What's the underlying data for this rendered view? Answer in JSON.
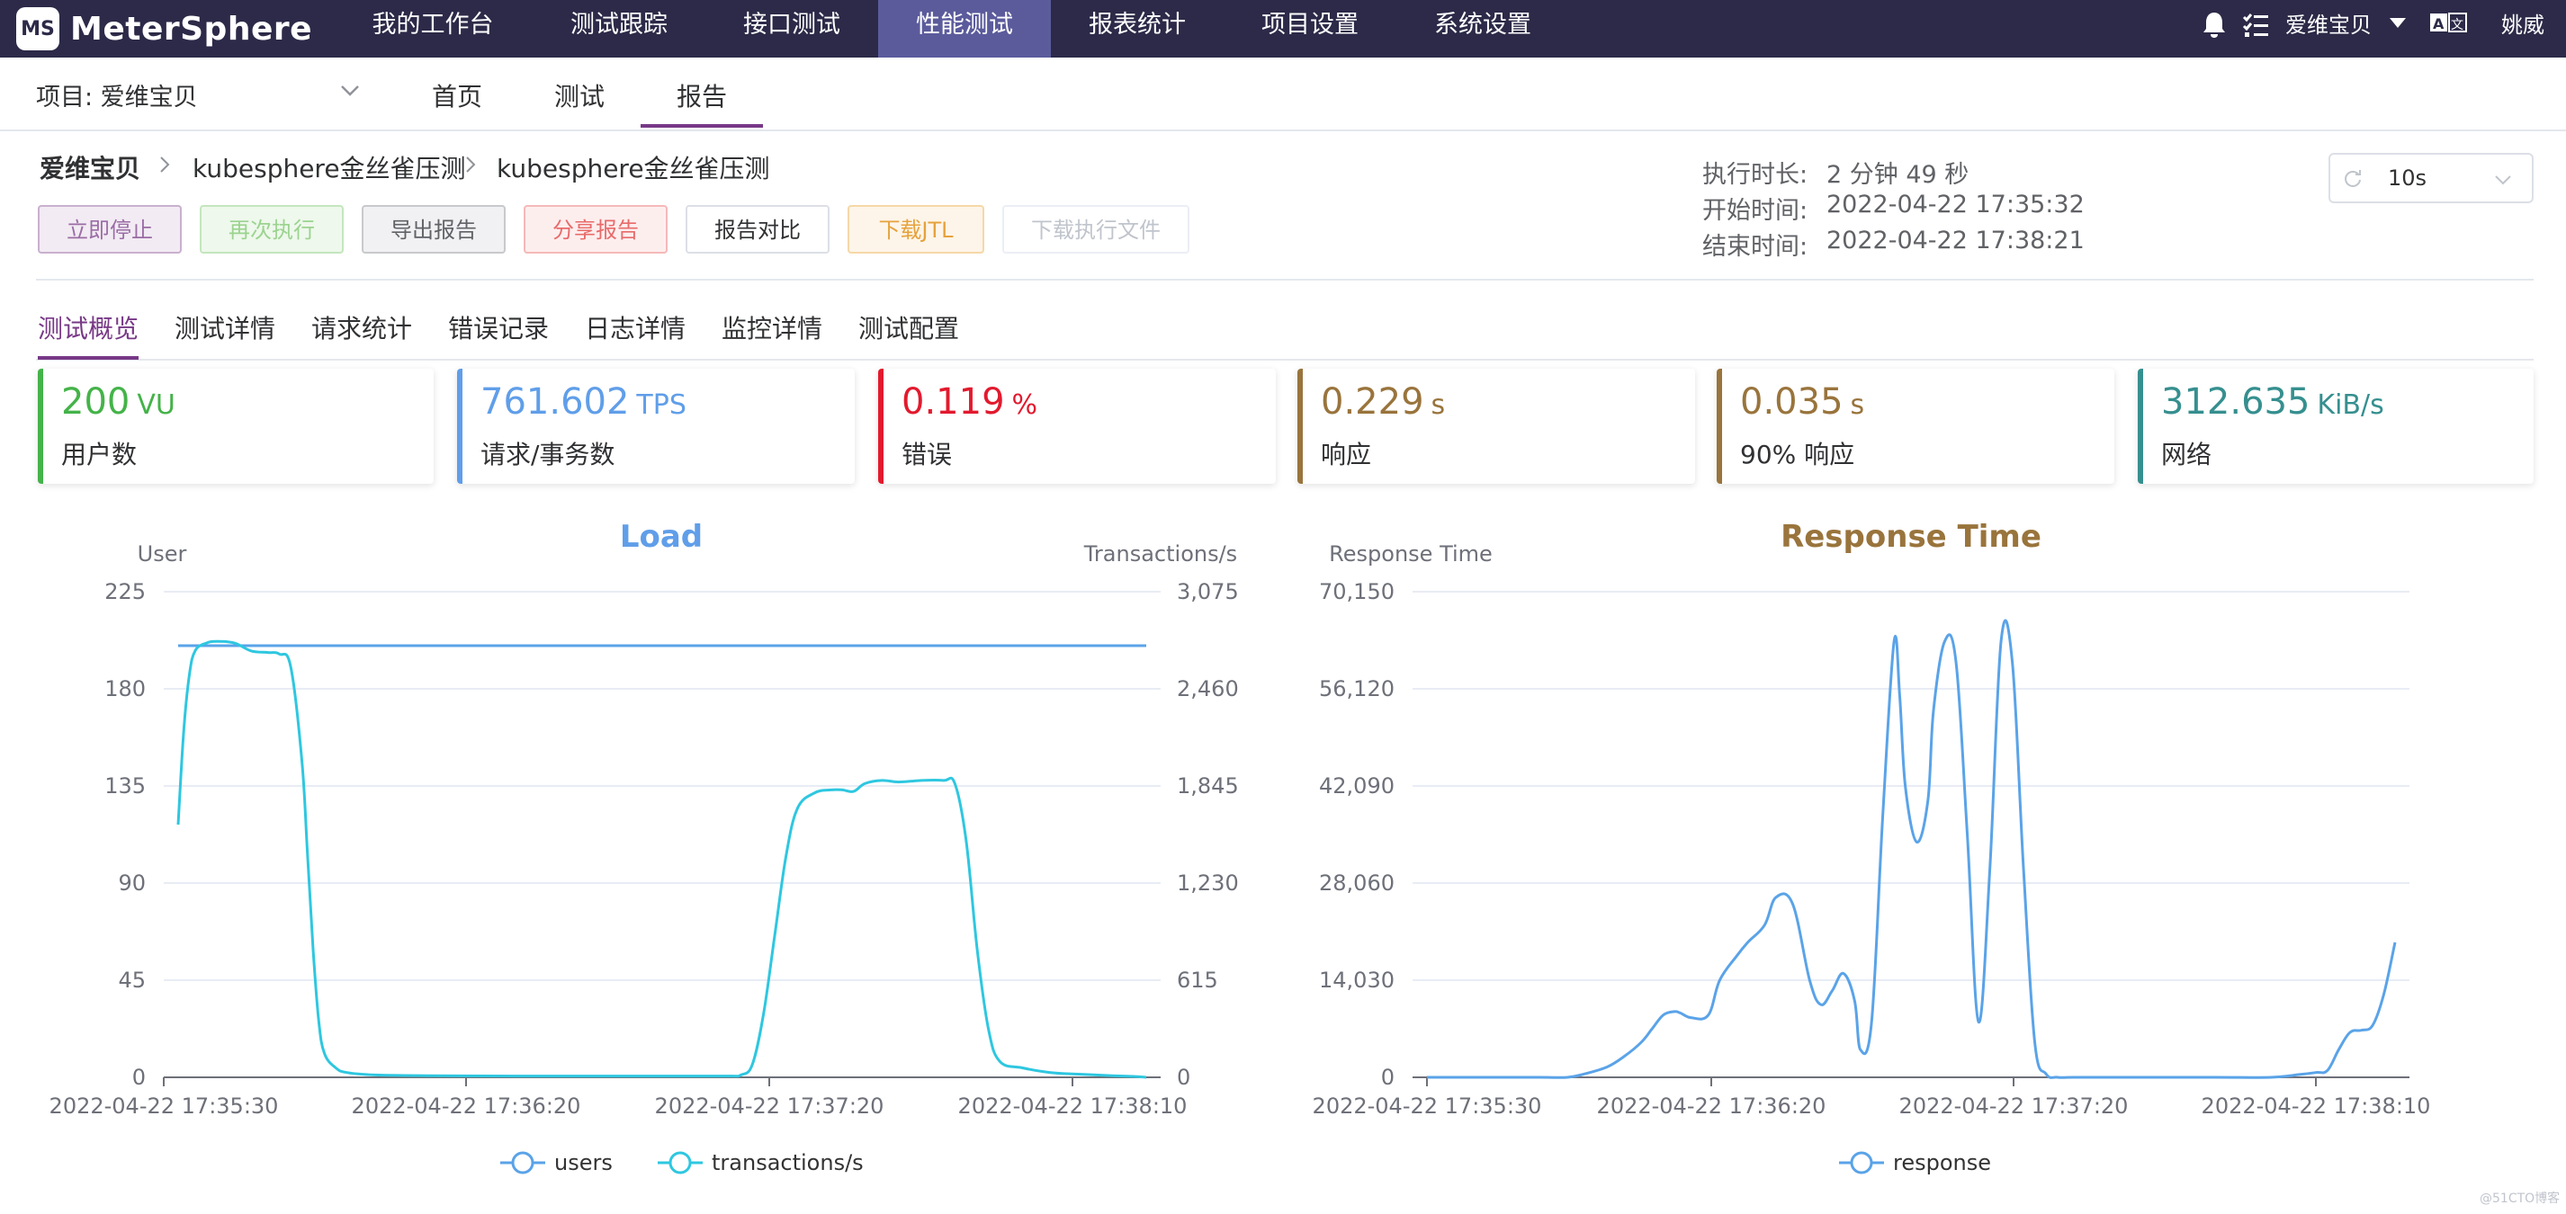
{
  "topnav": {
    "logo_text": "MeterSphere",
    "logo_mark": "MS",
    "items": [
      "我的工作台",
      "测试跟踪",
      "接口测试",
      "性能测试",
      "报表统计",
      "项目设置",
      "系统设置"
    ],
    "active": "性能测试",
    "user_workspace": "爱维宝贝",
    "lang_icon": "translate-icon",
    "user_name": "姚威"
  },
  "subnav": {
    "project_label": "项目: 爱维宝贝",
    "tabs": [
      "首页",
      "测试",
      "报告"
    ],
    "active": "报告"
  },
  "breadcrumb": [
    "爱维宝贝",
    "kubesphere金丝雀压测",
    "kubesphere金丝雀压测"
  ],
  "buttons": {
    "stop": "立即停止",
    "rerun": "再次执行",
    "export": "导出报告",
    "share": "分享报告",
    "compare": "报告对比",
    "download_jtl": "下载JTL",
    "download_files": "下载执行文件"
  },
  "meta": {
    "duration_label": "执行时长:",
    "duration_value": "2 分钟 49 秒",
    "start_label": "开始时间:",
    "start_value": "2022-04-22 17:35:32",
    "end_label": "结束时间:",
    "end_value": "2022-04-22 17:38:21",
    "refresh_interval": "10s"
  },
  "tabs": [
    "测试概览",
    "测试详情",
    "请求统计",
    "错误记录",
    "日志详情",
    "监控详情",
    "测试配置"
  ],
  "active_tab": "测试概览",
  "cards": [
    {
      "value": "200",
      "unit": "VU",
      "label": "用户数",
      "color": "#44b349"
    },
    {
      "value": "761.602",
      "unit": "TPS",
      "label": "请求/事务数",
      "color": "#609ee9"
    },
    {
      "value": "0.119",
      "unit": "%",
      "label": "错误",
      "color": "#e21a2e"
    },
    {
      "value": "0.229",
      "unit": "s",
      "label": "响应",
      "color": "#99743c"
    },
    {
      "value": "0.035",
      "unit": "s",
      "label": "90% 响应",
      "color": "#99743c"
    },
    {
      "value": "312.635",
      "unit": "KiB/s",
      "label": "网络",
      "color": "#368f8f"
    }
  ],
  "chart_data": [
    {
      "type": "line",
      "title": "Load",
      "ylabel": "User",
      "y2label": "Transactions/s",
      "ylim": [
        0,
        225
      ],
      "y2lim": [
        0,
        3075
      ],
      "yticks": [
        "0",
        "45",
        "90",
        "135",
        "180",
        "225"
      ],
      "y2ticks": [
        "0",
        "615",
        "1,230",
        "1,845",
        "2,460",
        "3,075"
      ],
      "xticks": [
        "2022-04-22 17:35:30",
        "2022-04-22 17:36:20",
        "2022-04-22 17:37:20",
        "2022-04-22 17:38:10"
      ],
      "grid": true,
      "legend_position": "bottom",
      "series": [
        {
          "name": "users",
          "axis": "left",
          "color": "#5aa3e8",
          "x": [
            0,
            2,
            4,
            6,
            8,
            10,
            12,
            14,
            16,
            18,
            20,
            22,
            24,
            26,
            28,
            30,
            32,
            34,
            36,
            38,
            40,
            42,
            44,
            46,
            48,
            50,
            52,
            54,
            56,
            58,
            60,
            62,
            64,
            66,
            68,
            70,
            72,
            74,
            76,
            78,
            80,
            82,
            84,
            86,
            88,
            90,
            92,
            94,
            96,
            98,
            100,
            102,
            104,
            106,
            108,
            110,
            112,
            114,
            116,
            118,
            120,
            122,
            124,
            126,
            128,
            130,
            132,
            134,
            136,
            138,
            140,
            142,
            144,
            146,
            148,
            150,
            152,
            154,
            156,
            158,
            160,
            162,
            164,
            166,
            168,
            170,
            172
          ],
          "y": [
            200,
            200,
            200,
            200,
            200,
            200,
            200,
            200,
            200,
            200,
            200,
            200,
            200,
            200,
            200,
            200,
            200,
            200,
            200,
            200,
            200,
            200,
            200,
            200,
            200,
            200,
            200,
            200,
            200,
            200,
            200,
            200,
            200,
            200,
            200,
            200,
            200,
            200,
            200,
            200,
            200,
            200,
            200,
            200,
            200,
            200,
            200,
            200,
            200,
            200,
            200,
            200,
            200,
            200,
            200,
            200,
            200,
            200,
            200,
            200,
            200,
            200,
            200,
            200,
            200,
            200,
            200,
            200,
            200,
            200,
            200,
            200,
            200,
            200,
            200,
            200,
            200,
            200,
            200,
            200,
            200,
            200,
            200,
            200,
            200,
            200,
            200
          ]
        },
        {
          "name": "transactions/s",
          "axis": "right",
          "color": "#2ec7e0",
          "x": [
            0,
            1,
            2,
            3,
            5,
            7,
            10,
            13,
            16,
            18,
            20,
            22,
            23,
            24,
            25,
            26,
            28,
            30,
            35,
            45,
            60,
            75,
            90,
            98,
            100,
            102,
            104,
            106,
            108,
            110,
            113,
            116,
            118,
            120,
            122,
            125,
            128,
            132,
            136,
            138,
            140,
            142,
            144,
            146,
            150,
            155,
            160,
            166,
            170,
            172
          ],
          "y": [
            1600,
            2200,
            2550,
            2700,
            2750,
            2760,
            2750,
            2700,
            2690,
            2680,
            2600,
            2000,
            1400,
            800,
            350,
            150,
            60,
            30,
            15,
            10,
            8,
            8,
            8,
            8,
            15,
            80,
            400,
            900,
            1400,
            1700,
            1800,
            1820,
            1820,
            1810,
            1860,
            1880,
            1870,
            1880,
            1880,
            1860,
            1500,
            800,
            300,
            100,
            60,
            30,
            20,
            10,
            5,
            0
          ]
        }
      ]
    },
    {
      "type": "line",
      "title": "Response Time",
      "ylabel": "Response Time",
      "ylim": [
        0,
        70150
      ],
      "yticks": [
        "0",
        "14,030",
        "28,060",
        "42,090",
        "56,120",
        "70,150"
      ],
      "xticks": [
        "2022-04-22 17:35:30",
        "2022-04-22 17:36:20",
        "2022-04-22 17:37:20",
        "2022-04-22 17:38:10"
      ],
      "grid": true,
      "legend_position": "bottom",
      "series": [
        {
          "name": "response",
          "color": "#5aa3e8",
          "x": [
            0,
            10,
            20,
            25,
            28,
            32,
            35,
            38,
            40,
            42,
            44,
            45,
            47,
            50,
            52,
            55,
            57,
            60,
            62,
            65,
            68,
            70,
            72,
            74,
            76,
            77,
            79,
            81,
            83,
            84,
            85,
            87,
            89,
            90,
            92,
            94,
            96,
            98,
            100,
            102,
            104,
            106,
            108,
            110,
            112,
            115,
            120,
            125,
            140,
            150,
            155,
            158,
            160,
            162,
            164,
            166,
            168,
            170,
            172
          ],
          "y": [
            0,
            0,
            0,
            0,
            500,
            1500,
            3000,
            5000,
            7000,
            9000,
            9500,
            9300,
            8600,
            9000,
            14000,
            17500,
            19500,
            22000,
            26000,
            25000,
            14000,
            10500,
            12500,
            15000,
            11000,
            4000,
            8000,
            38000,
            63000,
            55000,
            42000,
            34000,
            40000,
            53000,
            63000,
            60000,
            35000,
            8000,
            30000,
            63000,
            60000,
            30000,
            5000,
            500,
            0,
            0,
            0,
            0,
            0,
            0,
            400,
            700,
            1000,
            4000,
            6500,
            6800,
            7500,
            12000,
            19500
          ]
        }
      ]
    }
  ],
  "watermark": "@51CTO博客"
}
